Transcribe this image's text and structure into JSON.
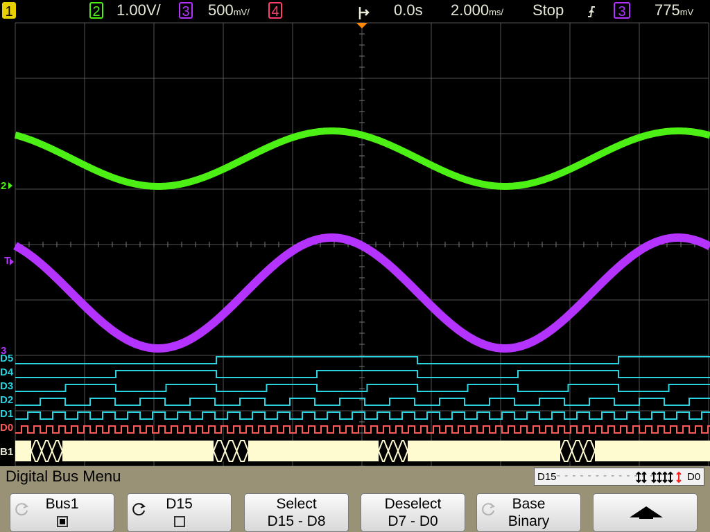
{
  "status_bar": {
    "ch1": "1",
    "ch2": "2",
    "ch2_scale": "1.00V/",
    "ch3": "3",
    "ch3_scale": "500",
    "ch3_scale_unit": "mV/",
    "ch4": "4",
    "delay": "0.0s",
    "timebase": "2.000",
    "timebase_unit": "ms/",
    "run_state": "Stop",
    "trigger_slope_icon": "rising-edge-icon",
    "trigger_source": "3",
    "trigger_level": "775",
    "trigger_level_unit": "mV"
  },
  "channel_markers": {
    "ch2": "2",
    "trig": "T",
    "ch3": "3",
    "digital": [
      "D5",
      "D4",
      "D3",
      "D2",
      "D1",
      "D0"
    ],
    "bus": "B1"
  },
  "colors": {
    "ch1": "#e8d000",
    "ch2": "#4cf014",
    "ch3": "#b433ff",
    "ch4": "#ff3f6a",
    "digital": "#2ad3e0",
    "d0": "#ff5a5a",
    "bus": "#fffbd0"
  },
  "menu": {
    "title": "Digital Bus Menu",
    "bus_indicator": {
      "left": "D15",
      "right": "D0"
    }
  },
  "softkeys": [
    {
      "label": "Bus1",
      "sub": "",
      "checked": true
    },
    {
      "label": "D15",
      "sub": "",
      "checked": false
    },
    {
      "label": "Select",
      "sub": "D15 - D8"
    },
    {
      "label": "Deselect",
      "sub": "D7 - D0"
    },
    {
      "label": "Base",
      "sub": "Binary"
    },
    {
      "label": "",
      "sub": "",
      "icon": "up-arrow-icon"
    }
  ]
}
